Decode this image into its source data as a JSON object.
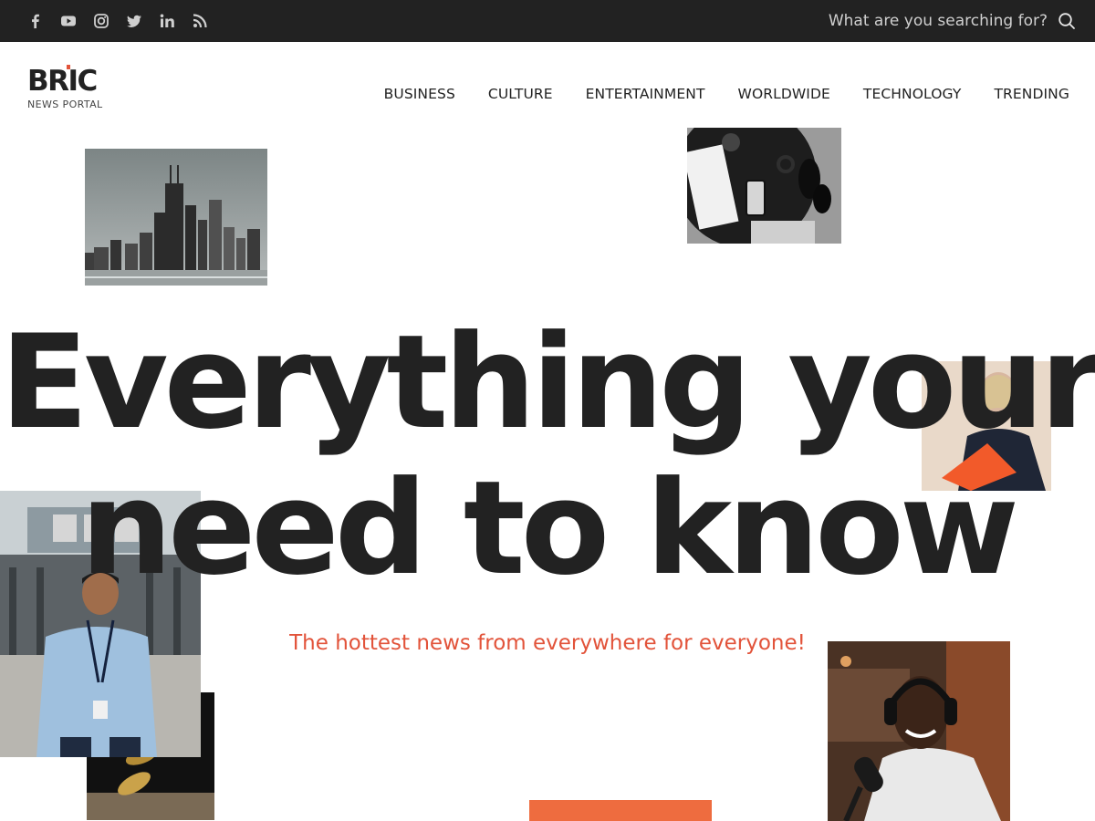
{
  "topbar": {
    "social_icons": [
      "facebook-icon",
      "youtube-icon",
      "instagram-icon",
      "twitter-icon",
      "linkedin-icon",
      "rss-icon"
    ],
    "search": {
      "placeholder": "What are you searching for?"
    },
    "background": "#222222"
  },
  "logo": {
    "title": "BRIC",
    "subtitle": "NEWS PORTAL",
    "accent": "#e2533a"
  },
  "nav": {
    "items": [
      "BUSINESS",
      "CULTURE",
      "ENTERTAINMENT",
      "WORLDWIDE",
      "TECHNOLOGY",
      "TRENDING"
    ]
  },
  "hero": {
    "line1": "Everything your",
    "line2": "need to know",
    "subtitle": "The hottest news from everywhere for everyone!",
    "accent": "#e2533a",
    "cta_color": "#ee6c3f"
  },
  "photos": [
    "city-skyline-photo",
    "fashion-flatlay-photo",
    "woman-orange-folder-photo",
    "man-bbc-photo",
    "falling-coins-photo",
    "podcaster-photo"
  ]
}
